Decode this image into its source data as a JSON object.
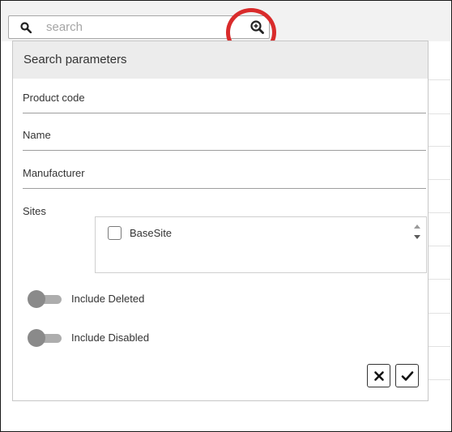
{
  "search": {
    "placeholder": "search",
    "search_icon": "search-icon",
    "advanced_icon": "zoom-in-icon"
  },
  "panel": {
    "title": "Search parameters",
    "fields": [
      {
        "label": "Product code"
      },
      {
        "label": "Name"
      },
      {
        "label": "Manufacturer"
      }
    ],
    "sites": {
      "label": "Sites",
      "options": [
        {
          "label": "BaseSite",
          "checked": false
        }
      ]
    },
    "toggles": [
      {
        "label": "Include Deleted",
        "on": false
      },
      {
        "label": "Include Disabled",
        "on": false
      }
    ],
    "actions": {
      "cancel_icon": "close-icon",
      "confirm_icon": "check-icon"
    }
  },
  "colors": {
    "highlight": "#d92b2b",
    "header_bg": "#ececec",
    "toggle_off": "#8a8a8a"
  }
}
